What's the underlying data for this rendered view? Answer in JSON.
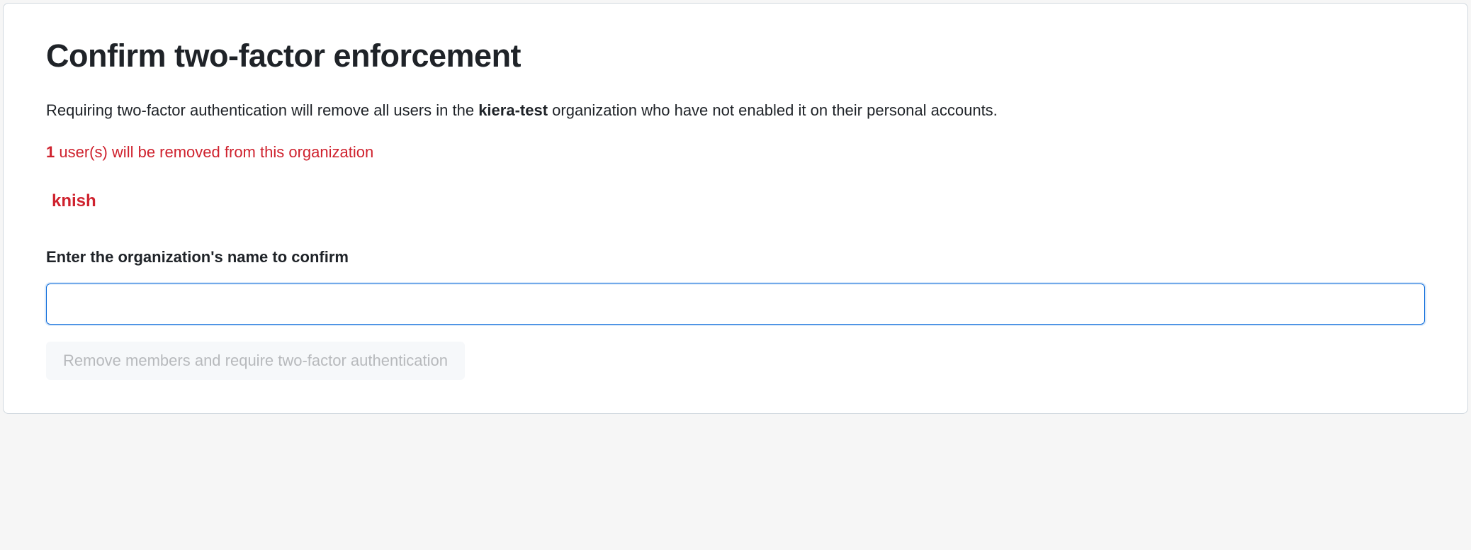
{
  "header": {
    "title": "Confirm two-factor enforcement"
  },
  "description": {
    "prefix": "Requiring two-factor authentication will remove all users in the ",
    "org_name": "kiera-test",
    "suffix": " organization who have not enabled it on their personal accounts."
  },
  "warning": {
    "count": "1",
    "text": " user(s) will be removed from this organization"
  },
  "users": [
    "knish"
  ],
  "confirm": {
    "label": "Enter the organization's name to confirm",
    "input_value": ""
  },
  "submit": {
    "label": "Remove members and require two-factor authentication"
  },
  "colors": {
    "danger": "#cf222e",
    "focus_border": "#0969da",
    "text": "#1f2328"
  }
}
